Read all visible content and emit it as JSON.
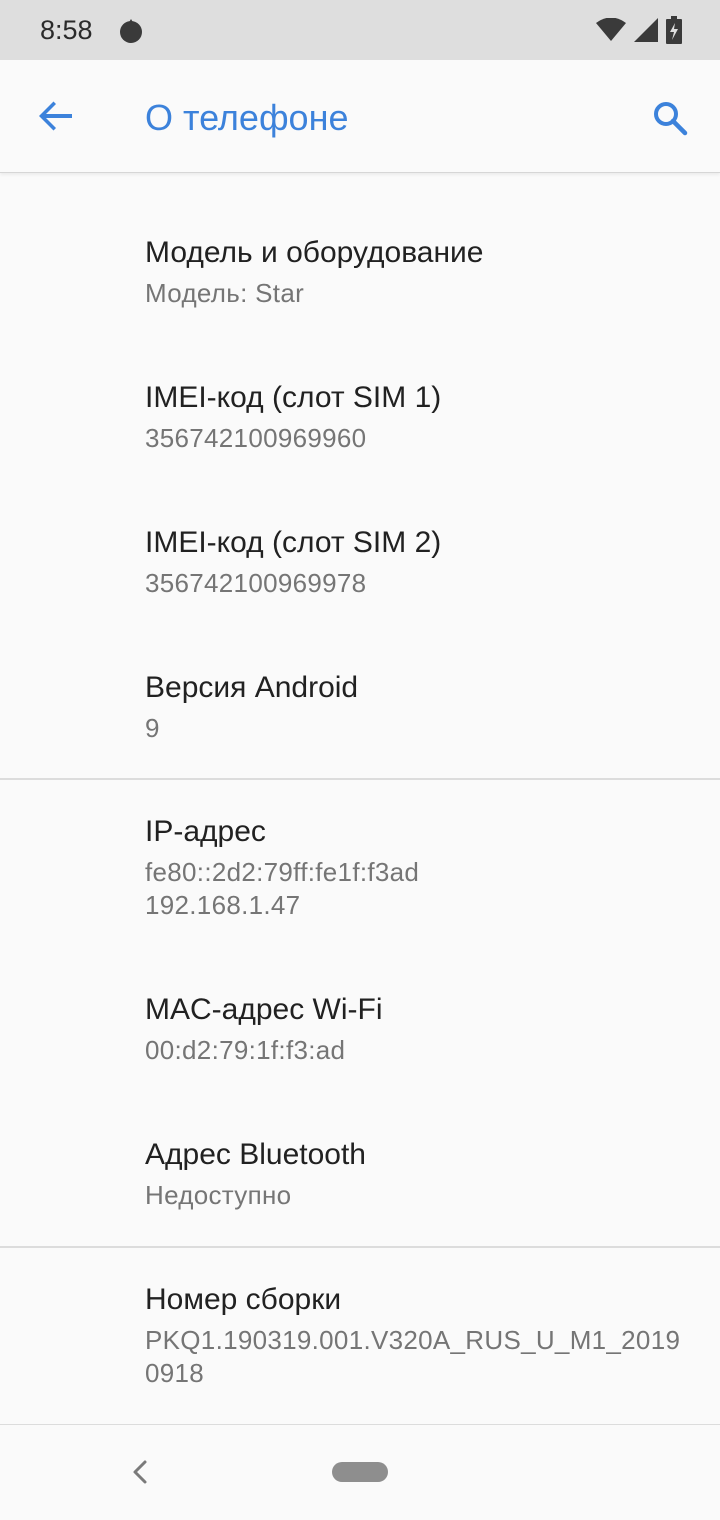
{
  "status_bar": {
    "time": "8:58",
    "icons": [
      "notification-icon",
      "wifi-icon",
      "signal-icon",
      "battery-charging-icon"
    ]
  },
  "app_bar": {
    "title": "О телефоне",
    "accent_color": "#3c82db"
  },
  "items": [
    {
      "title": "Модель и оборудование",
      "summary": "Модель: Star"
    },
    {
      "title": "IMEI-код (слот SIM 1)",
      "summary": "356742100969960"
    },
    {
      "title": "IMEI-код (слот SIM 2)",
      "summary": "356742100969978"
    },
    {
      "title": "Версия Android",
      "summary": "9"
    },
    {
      "title": "IP-адрес",
      "summary": "fe80::2d2:79ff:fe1f:f3ad\n192.168.1.47"
    },
    {
      "title": "MAC-адрес Wi-Fi",
      "summary": "00:d2:79:1f:f3:ad"
    },
    {
      "title": "Адрес Bluetooth",
      "summary": "Недоступно"
    },
    {
      "title": "Номер сборки",
      "summary": "PKQ1.190319.001.V320A_RUS_U_M1_20190918"
    }
  ]
}
